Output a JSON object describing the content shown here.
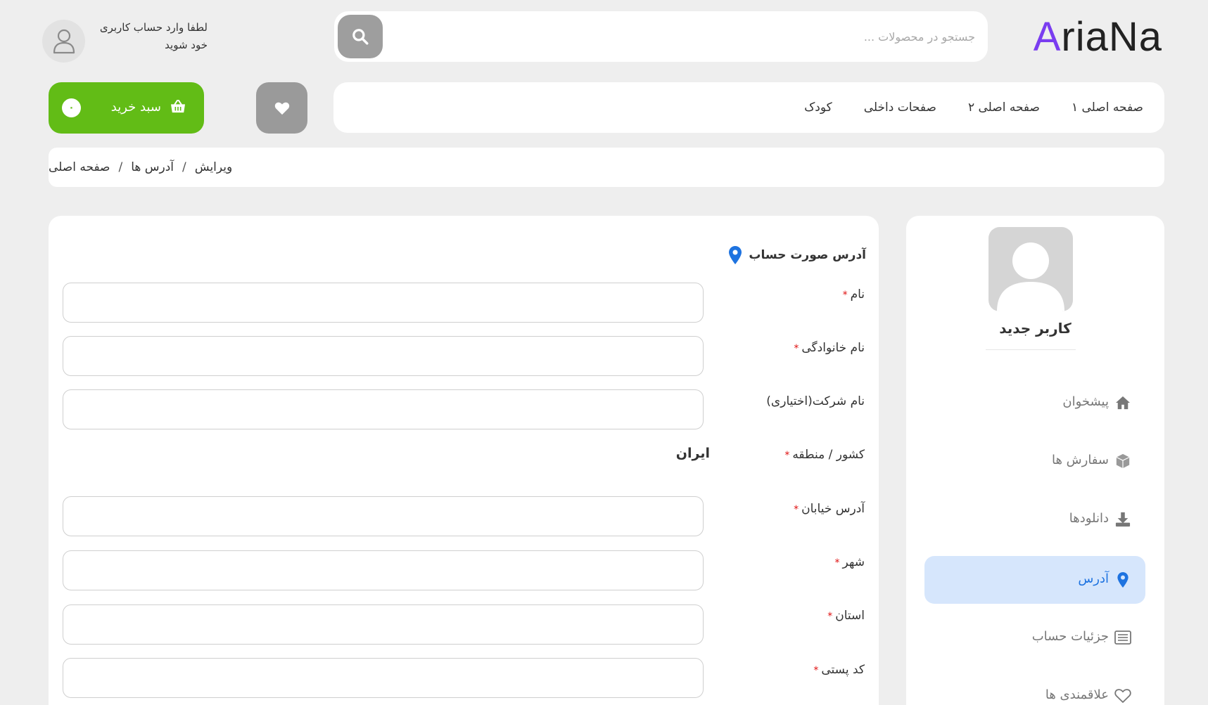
{
  "header": {
    "logo_first": "A",
    "logo_rest": "riaNa",
    "search_placeholder": "جستجو در محصولات ...",
    "login_line1": "لطفا وارد حساب کاربری",
    "login_line2": "خود شوید"
  },
  "nav": {
    "items": [
      "صفحه اصلی ۱",
      "صفحه اصلی ۲",
      "صفحات داخلی",
      "کودک"
    ]
  },
  "cart": {
    "label": "سبد خرید",
    "count": "۰"
  },
  "breadcrumb": {
    "items": [
      "صفحه اصلی",
      "آدرس ها",
      "ویرایش"
    ],
    "separator": "/"
  },
  "form": {
    "section_title": "آدرس صورت حساب",
    "required_mark": "*",
    "fields": {
      "first_name": "نام",
      "last_name": "نام خانوادگی",
      "company": "نام شرکت(اختیاری)",
      "country": "کشور / منطقه",
      "street": "آدرس خیابان",
      "city": "شهر",
      "state": "استان",
      "postcode": "کد پستی"
    },
    "country_value": "ایران"
  },
  "sidebar": {
    "user_name": "کاربر جدید",
    "menu": [
      {
        "label": "پیشخوان",
        "icon": "home-icon"
      },
      {
        "label": "سفارش ها",
        "icon": "box-icon"
      },
      {
        "label": "دانلودها",
        "icon": "download-icon"
      },
      {
        "label": "آدرس",
        "icon": "map-pin-icon",
        "active": true
      },
      {
        "label": "جزئیات حساب",
        "icon": "id-card-icon"
      },
      {
        "label": "علاقمندی ها",
        "icon": "heart-outline-icon"
      }
    ]
  },
  "colors": {
    "background": "#eeeeee",
    "logo_accent": "#7a3df0",
    "cart_green": "#62bc16",
    "active_blue": "#1e73e0",
    "active_bg": "#d6e6fc",
    "required_red": "#e01010"
  }
}
